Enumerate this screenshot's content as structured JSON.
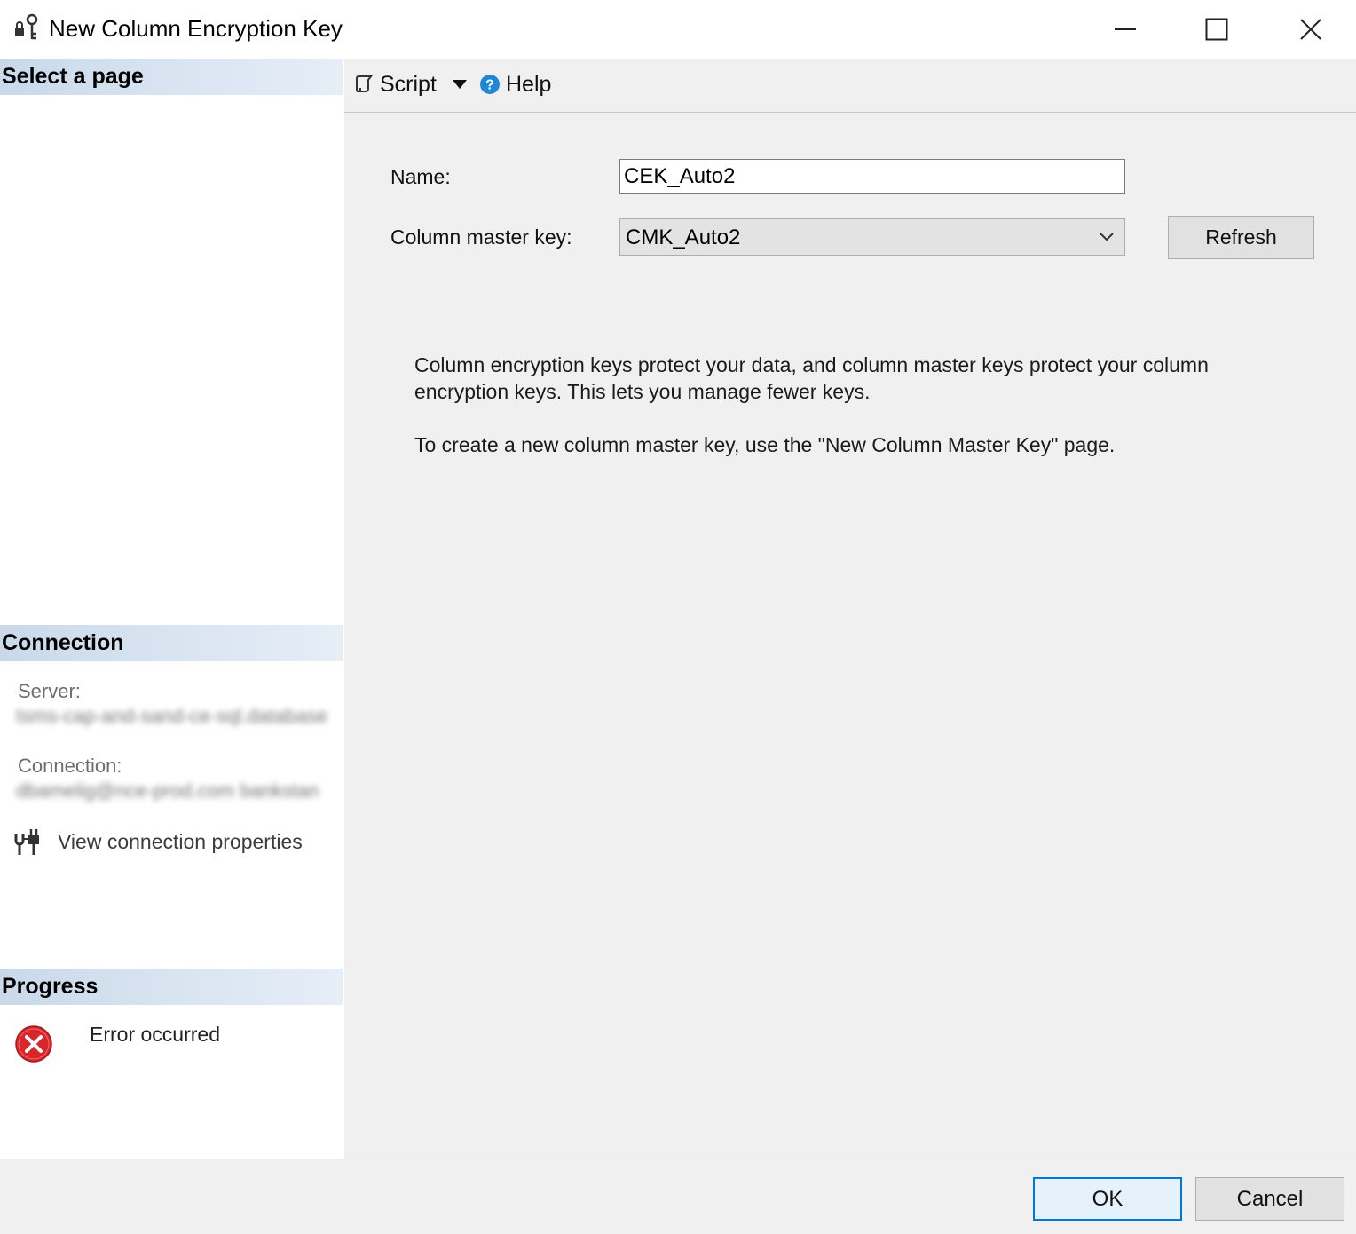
{
  "window": {
    "title": "New Column Encryption Key",
    "icon": "key-lock-icon",
    "controls": [
      "minimize-icon",
      "maximize-icon",
      "close-icon"
    ]
  },
  "left_panel": {
    "select_page_heading": "Select a page",
    "connection": {
      "heading": "Connection",
      "server_label": "Server:",
      "server_value": "tsms-cap-and-sand-ce-sql.database",
      "connection_label": "Connection:",
      "connection_value": "dbamelig@nce-prod.com bankstan",
      "view_properties_label": "View connection properties",
      "view_properties_icon": "connection-properties-icon"
    },
    "progress": {
      "heading": "Progress",
      "status_text": "Error occurred",
      "status_icon": "error-icon"
    }
  },
  "toolbar": {
    "script_label": "Script",
    "script_icon": "script-icon",
    "dropdown_icon": "triangle-down-icon",
    "help_label": "Help",
    "help_icon": "help-icon"
  },
  "form": {
    "name_label": "Name:",
    "name_value": "CEK_Auto2",
    "cmk_label": "Column master key:",
    "cmk_value": "CMK_Auto2",
    "refresh_label": "Refresh"
  },
  "description": {
    "line1": "Column encryption keys protect your data, and column master keys protect your column encryption keys. This lets you manage fewer keys.",
    "line2": "To create a new column master key, use the \"New Column Master Key\" page."
  },
  "footer": {
    "ok_label": "OK",
    "cancel_label": "Cancel"
  },
  "colors": {
    "section_header": "#c9d9ea",
    "accent": "#0078d7",
    "error": "#d9262b"
  }
}
